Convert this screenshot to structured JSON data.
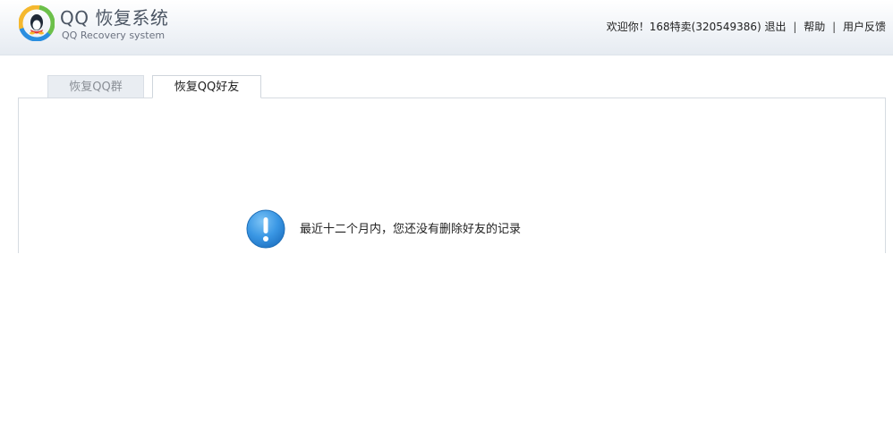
{
  "header": {
    "brand_title": "QQ 恢复系统",
    "brand_subtitle": "QQ Recovery system",
    "welcome_text": "欢迎你！168特卖(320549386)",
    "logout_label": "退出",
    "help_label": "帮助",
    "feedback_label": "用户反馈",
    "separator": "|"
  },
  "tabs": [
    {
      "label": "恢复QQ群",
      "active": false
    },
    {
      "label": "恢复QQ好友",
      "active": true
    }
  ],
  "content": {
    "icon": "info-icon",
    "message": "最近十二个月内，您还没有删除好友的记录"
  },
  "colors": {
    "accent_blue": "#2f8fe0",
    "logo_yellow": "#f5b82e",
    "logo_green": "#6cc04a",
    "logo_blue": "#2a8ee0"
  }
}
